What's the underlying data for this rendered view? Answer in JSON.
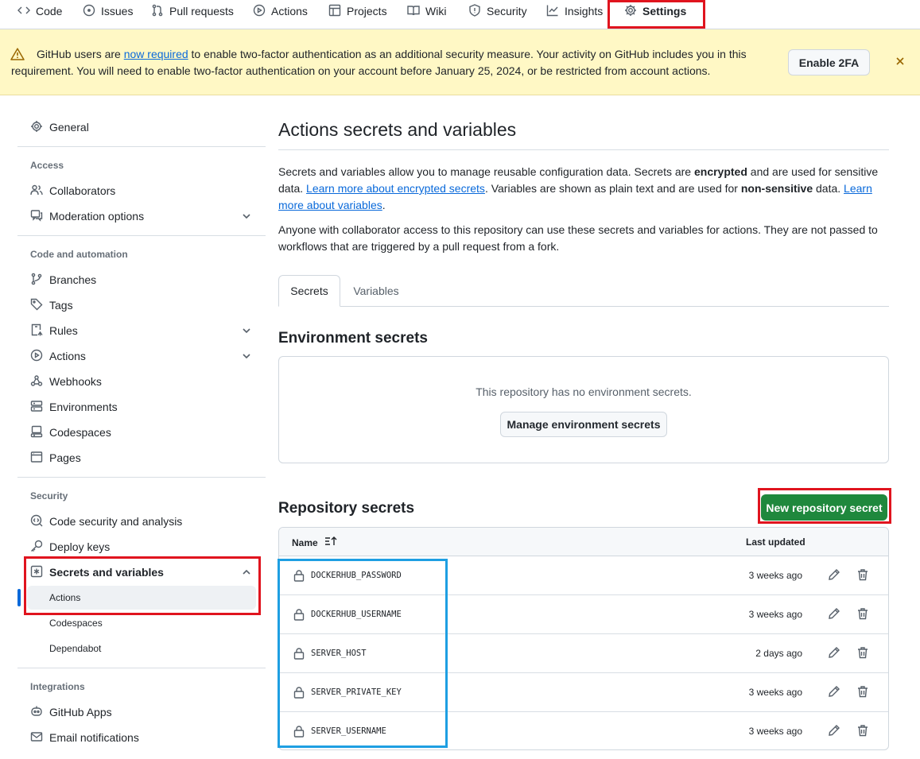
{
  "topnav": {
    "tabs": [
      {
        "label": "Code",
        "icon": "code-icon"
      },
      {
        "label": "Issues",
        "icon": "issue-icon"
      },
      {
        "label": "Pull requests",
        "icon": "pull-request-icon"
      },
      {
        "label": "Actions",
        "icon": "play-icon"
      },
      {
        "label": "Projects",
        "icon": "table-icon"
      },
      {
        "label": "Wiki",
        "icon": "book-icon"
      },
      {
        "label": "Security",
        "icon": "shield-icon"
      },
      {
        "label": "Insights",
        "icon": "graph-icon"
      },
      {
        "label": "Settings",
        "icon": "gear-icon"
      }
    ]
  },
  "banner": {
    "text_before": "GitHub users are ",
    "link": "now required",
    "text_after": " to enable two-factor authentication as an additional security measure. Your activity on GitHub includes you in this requirement. You will need to enable two-factor authentication on your account before January 25, 2024, or be restricted from account actions.",
    "button": "Enable 2FA"
  },
  "sidebar": {
    "general": "General",
    "access_heading": "Access",
    "collaborators": "Collaborators",
    "moderation": "Moderation options",
    "code_heading": "Code and automation",
    "branches": "Branches",
    "tags": "Tags",
    "rules": "Rules",
    "actions": "Actions",
    "webhooks": "Webhooks",
    "environments": "Environments",
    "codespaces": "Codespaces",
    "pages": "Pages",
    "security_heading": "Security",
    "code_security": "Code security and analysis",
    "deploy_keys": "Deploy keys",
    "secrets": "Secrets and variables",
    "sub_actions": "Actions",
    "sub_codespaces": "Codespaces",
    "sub_dependabot": "Dependabot",
    "integrations_heading": "Integrations",
    "github_apps": "GitHub Apps",
    "email_notifications": "Email notifications"
  },
  "main": {
    "title": "Actions secrets and variables",
    "p1_a": "Secrets and variables allow you to manage reusable configuration data. Secrets are ",
    "p1_b": "encrypted",
    "p1_c": " and are used for sensitive data. ",
    "p1_link1": "Learn more about encrypted secrets",
    "p1_d": ". Variables are shown as plain text and are used for ",
    "p1_e": "non-sensitive",
    "p1_f": " data. ",
    "p1_link2": "Learn more about variables",
    "p1_g": ".",
    "p2": "Anyone with collaborator access to this repository can use these secrets and variables for actions. They are not passed to workflows that are triggered by a pull request from a fork.",
    "tab_secrets": "Secrets",
    "tab_variables": "Variables",
    "env_heading": "Environment secrets",
    "env_empty": "This repository has no environment secrets.",
    "env_button": "Manage environment secrets",
    "repo_heading": "Repository secrets",
    "new_secret_button": "New repository secret",
    "col_name": "Name",
    "col_updated": "Last updated",
    "secrets": [
      {
        "name": "DOCKERHUB_PASSWORD",
        "updated": "3 weeks ago"
      },
      {
        "name": "DOCKERHUB_USERNAME",
        "updated": "3 weeks ago"
      },
      {
        "name": "SERVER_HOST",
        "updated": "2 days ago"
      },
      {
        "name": "SERVER_PRIVATE_KEY",
        "updated": "3 weeks ago"
      },
      {
        "name": "SERVER_USERNAME",
        "updated": "3 weeks ago"
      }
    ]
  },
  "colors": {
    "accent_link": "#0969da",
    "primary_green": "#1f883d",
    "banner_bg": "#fff8c5",
    "highlight_red": "#e0141e",
    "highlight_blue": "#1e9fe2"
  }
}
